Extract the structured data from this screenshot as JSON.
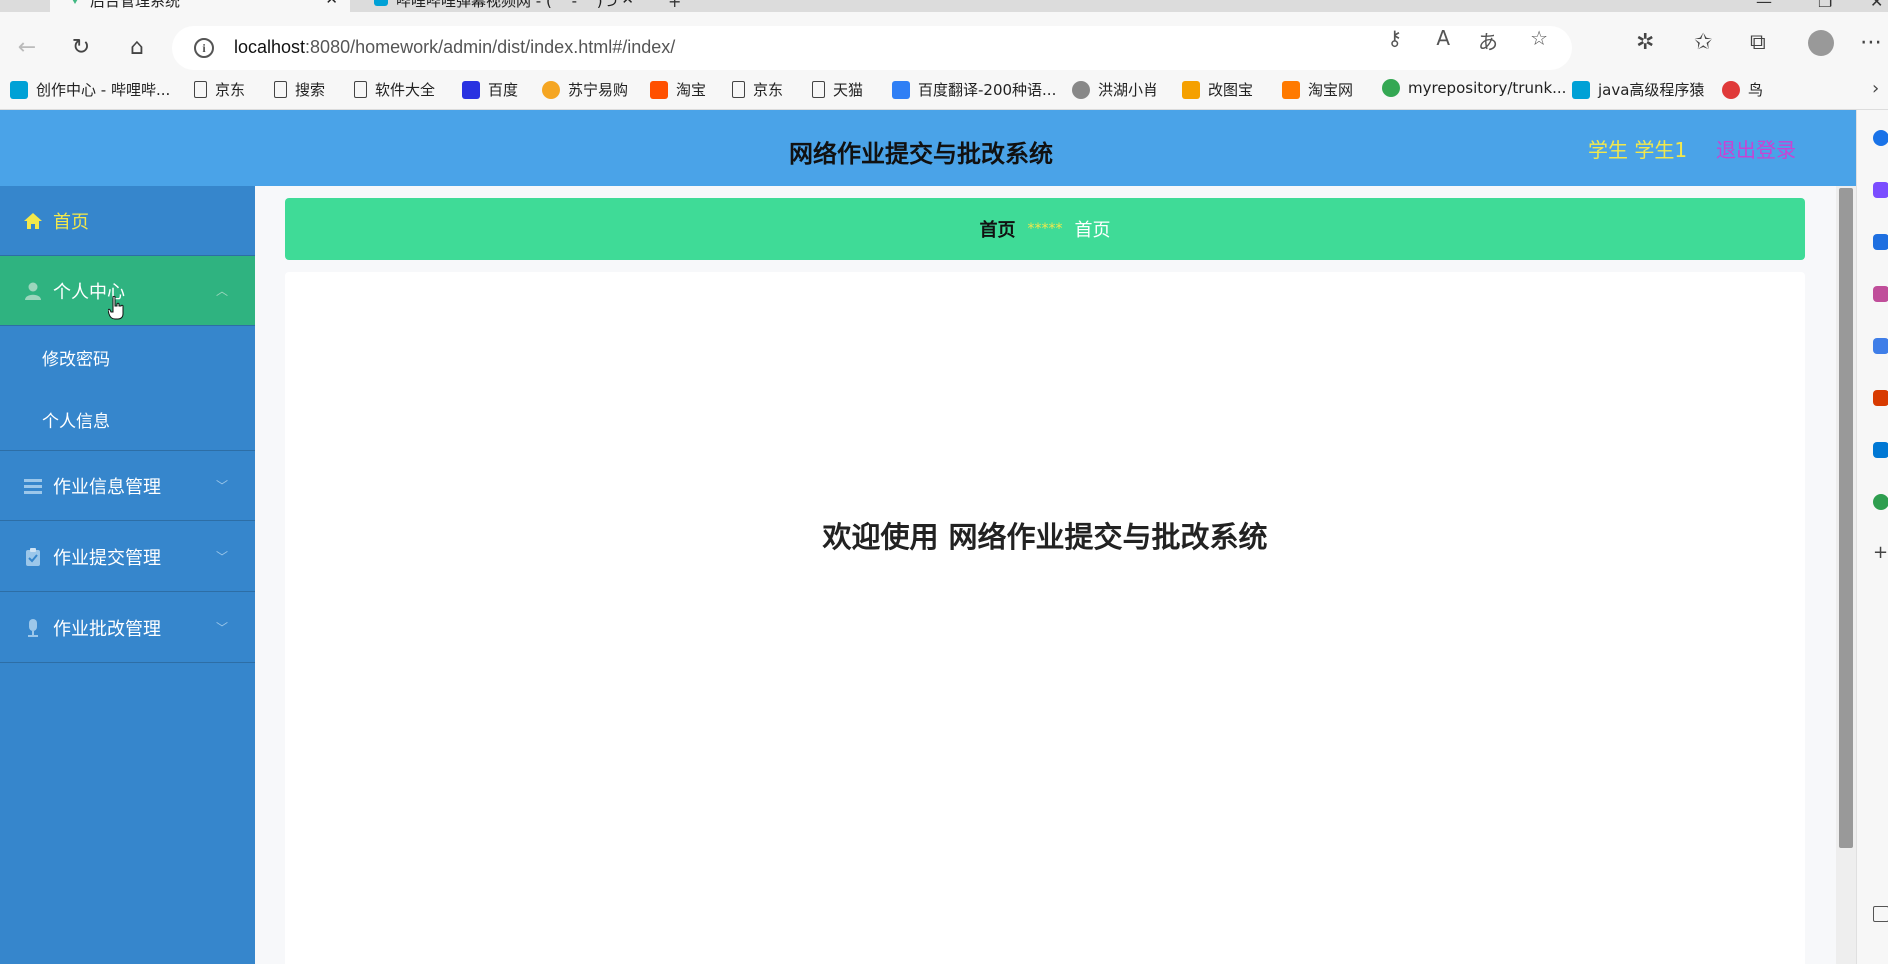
{
  "browser": {
    "tabs": [
      {
        "title": "后台管理系统",
        "active": true
      },
      {
        "title": "哔哩哔哩弹幕视频网 - ( ゜- ゜)つ",
        "active": false
      }
    ],
    "url_host": "localhost",
    "url_rest": ":8080/homework/admin/dist/index.html#/index/",
    "info_icon_glyph": "i",
    "bookmarks": [
      {
        "label": "创作中心 - 哔哩哔...",
        "icon": "bilibili-icon",
        "color": "#00a1d6"
      },
      {
        "label": "京东",
        "icon": "doc-icon"
      },
      {
        "label": "搜索",
        "icon": "doc-icon"
      },
      {
        "label": "软件大全",
        "icon": "doc-icon"
      },
      {
        "label": "百度",
        "icon": "baidu-icon",
        "color": "#2932e1"
      },
      {
        "label": "苏宁易购",
        "icon": "suning-icon",
        "color": "#f5a623"
      },
      {
        "label": "淘宝",
        "icon": "taobao-icon",
        "color": "#ff5000"
      },
      {
        "label": "京东",
        "icon": "doc-icon"
      },
      {
        "label": "天猫",
        "icon": "doc-icon"
      },
      {
        "label": "百度翻译-200种语...",
        "icon": "translate-icon",
        "color": "#2f7ff5"
      },
      {
        "label": "洪湖小肖",
        "icon": "bird-icon",
        "color": "#888888"
      },
      {
        "label": "改图宝",
        "icon": "gaitubao-icon",
        "color": "#f5a000"
      },
      {
        "label": "淘宝网",
        "icon": "taobao-icon",
        "color": "#ff7a00"
      },
      {
        "label": "myrepository/trunk...",
        "icon": "chrome-icon",
        "color": "#34a853"
      },
      {
        "label": "java高级程序猿",
        "icon": "bilibili-icon",
        "color": "#00a1d6"
      },
      {
        "label": "鸟",
        "icon": "swallow-icon",
        "color": "#e03a3a"
      }
    ]
  },
  "header": {
    "title": "网络作业提交与批改系统",
    "user": "学生 学生1",
    "logout": "退出登录"
  },
  "sidebar": {
    "items": [
      {
        "label": "首页",
        "icon": "home-icon",
        "active_text": true
      },
      {
        "label": "个人中心",
        "icon": "user-icon",
        "expanded": true
      },
      {
        "label": "修改密码",
        "sub": true
      },
      {
        "label": "个人信息",
        "sub": true
      },
      {
        "label": "作业信息管理",
        "icon": "list-icon"
      },
      {
        "label": "作业提交管理",
        "icon": "clipboard-icon"
      },
      {
        "label": "作业批改管理",
        "icon": "microphone-icon"
      }
    ]
  },
  "breadcrumb": {
    "home": "首页",
    "separator": "*****",
    "current": "首页"
  },
  "main": {
    "welcome": "欢迎使用 网络作业提交与批改系统"
  },
  "colors": {
    "header_bg": "#4aa3e8",
    "sidebar_bg": "#3686cc",
    "sidebar_active": "#2fb380",
    "breadcrumb_bg": "#3fdb97",
    "user_text": "#f3e84b",
    "logout_text": "#c843d4"
  }
}
